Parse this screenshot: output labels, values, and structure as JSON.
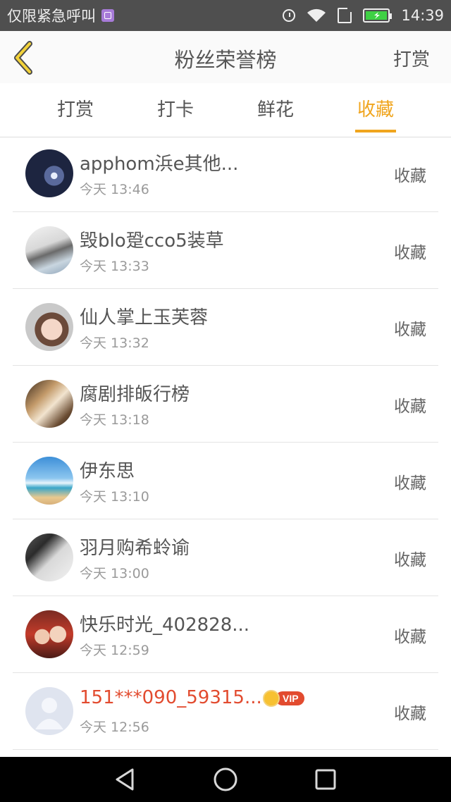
{
  "status_bar": {
    "carrier_text": "仅限紧急呼叫",
    "time": "14:39",
    "icons": [
      "app-notification-icon",
      "alarm-icon",
      "wifi-icon",
      "sim-icon",
      "battery-icon"
    ]
  },
  "header": {
    "title": "粉丝荣誉榜",
    "right_action": "打赏",
    "back_icon": "chevron-left-icon"
  },
  "tabs": [
    {
      "label": "打赏",
      "active": false
    },
    {
      "label": "打卡",
      "active": false
    },
    {
      "label": "鲜花",
      "active": false
    },
    {
      "label": "收藏",
      "active": true
    }
  ],
  "colors": {
    "accent": "#f0a51e",
    "status_bar_bg": "#4f4f4f",
    "vip_name": "#e24b2f",
    "battery_green": "#3fd044"
  },
  "list": [
    {
      "name": "apphom浜e其他...",
      "time": "今天 13:46",
      "action": "收藏",
      "vip": false
    },
    {
      "name": "毁blo跫cco5装草",
      "time": "今天 13:33",
      "action": "收藏",
      "vip": false
    },
    {
      "name": "仙人掌上玉芙蓉",
      "time": "今天 13:32",
      "action": "收藏",
      "vip": false
    },
    {
      "name": "腐剧排皈行榜",
      "time": "今天 13:18",
      "action": "收藏",
      "vip": false
    },
    {
      "name": "伊东思",
      "time": "今天 13:10",
      "action": "收藏",
      "vip": false
    },
    {
      "name": "羽月购希蛉谕",
      "time": "今天 13:00",
      "action": "收藏",
      "vip": false
    },
    {
      "name": "快乐时光_402828...",
      "time": "今天 12:59",
      "action": "收藏",
      "vip": false
    },
    {
      "name": "151***090_59315...",
      "time": "今天 12:56",
      "action": "收藏",
      "vip": true,
      "vip_label": "VIP"
    }
  ],
  "nav_bar": [
    "back-triangle-icon",
    "home-circle-icon",
    "recents-square-icon"
  ]
}
